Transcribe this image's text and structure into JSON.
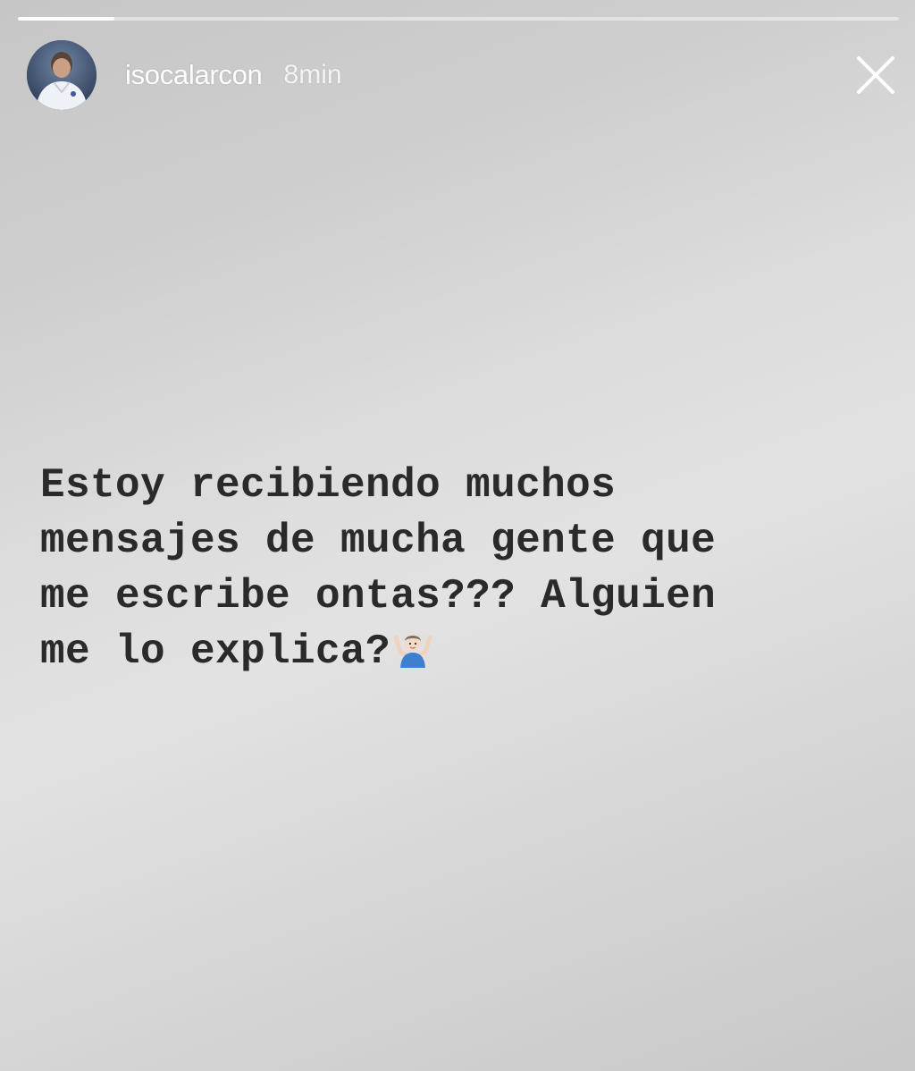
{
  "story": {
    "username": "isocalarcon",
    "timestamp": "8min",
    "progress": 0.11,
    "message": "Estoy recibiendo muchos\nmensajes de mucha gente que\nme escribe ontas??? Alguien\nme lo explica?",
    "message_emoji": "person-shrugging-icon"
  },
  "icons": {
    "close": "close-icon",
    "avatar": "avatar"
  },
  "colors": {
    "background": "#d9d9d9",
    "text": "#2a2a2a",
    "header_text": "#ffffff"
  }
}
